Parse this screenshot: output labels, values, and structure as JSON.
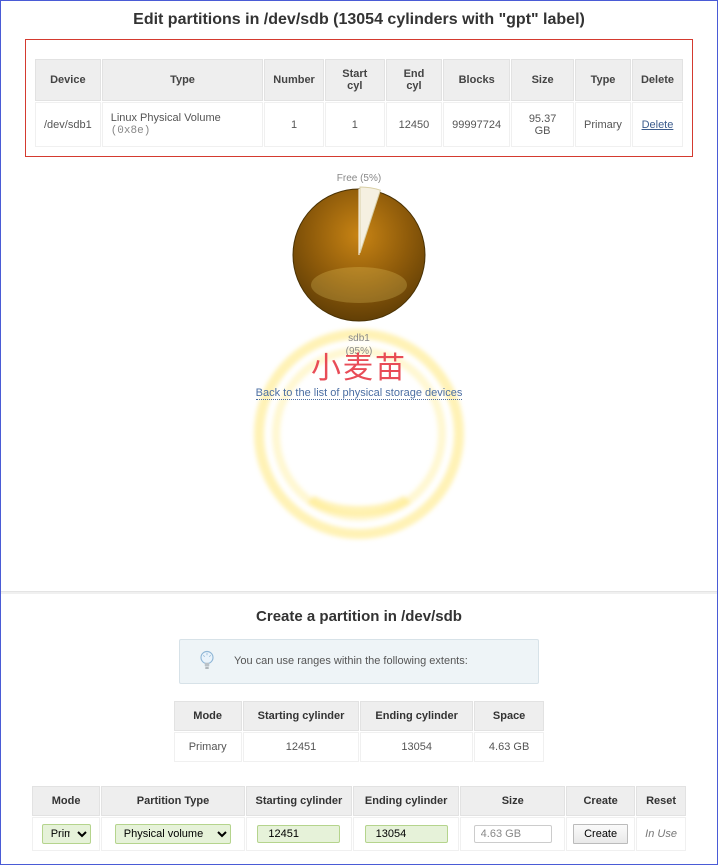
{
  "top": {
    "title": "Edit partitions in /dev/sdb (13054 cylinders with \"gpt\" label)",
    "headers": {
      "device": "Device",
      "type": "Type",
      "number": "Number",
      "start": "Start cyl",
      "end": "End cyl",
      "blocks": "Blocks",
      "size": "Size",
      "ptype": "Type",
      "delete": "Delete"
    },
    "row": {
      "device": "/dev/sdb1",
      "type": "Linux Physical Volume",
      "hex": "(0x8e)",
      "number": "1",
      "start": "1",
      "end": "12450",
      "blocks": "99997724",
      "size": "95.37 GB",
      "ptype": "Primary",
      "delete": "Delete"
    }
  },
  "chart": {
    "free_label": "Free (5%)",
    "main_name": "sdb1",
    "main_pct": "(95%)"
  },
  "chart_data": {
    "type": "pie",
    "title": "",
    "series": [
      {
        "name": "sdb1",
        "value": 95
      },
      {
        "name": "Free",
        "value": 5
      }
    ]
  },
  "watermark": "小麦苗",
  "back_link": "Back to the list of physical storage devices",
  "create": {
    "title": "Create a partition in /dev/sdb",
    "hint": "You can use ranges within the following extents:",
    "ext_headers": {
      "mode": "Mode",
      "start": "Starting cylinder",
      "end": "Ending cylinder",
      "space": "Space"
    },
    "ext_row": {
      "mode": "Primary",
      "start": "12451",
      "end": "13054",
      "space": "4.63 GB"
    },
    "form_headers": {
      "mode": "Mode",
      "ptype": "Partition Type",
      "start": "Starting cylinder",
      "end": "Ending cylinder",
      "size": "Size",
      "create": "Create",
      "reset": "Reset"
    },
    "form_row": {
      "mode_selected": "Primary",
      "ptype_selected": "Physical volume",
      "start": "12451",
      "end": "13054",
      "size": "4.63 GB",
      "create_btn": "Create",
      "reset_text": "In Use"
    }
  }
}
